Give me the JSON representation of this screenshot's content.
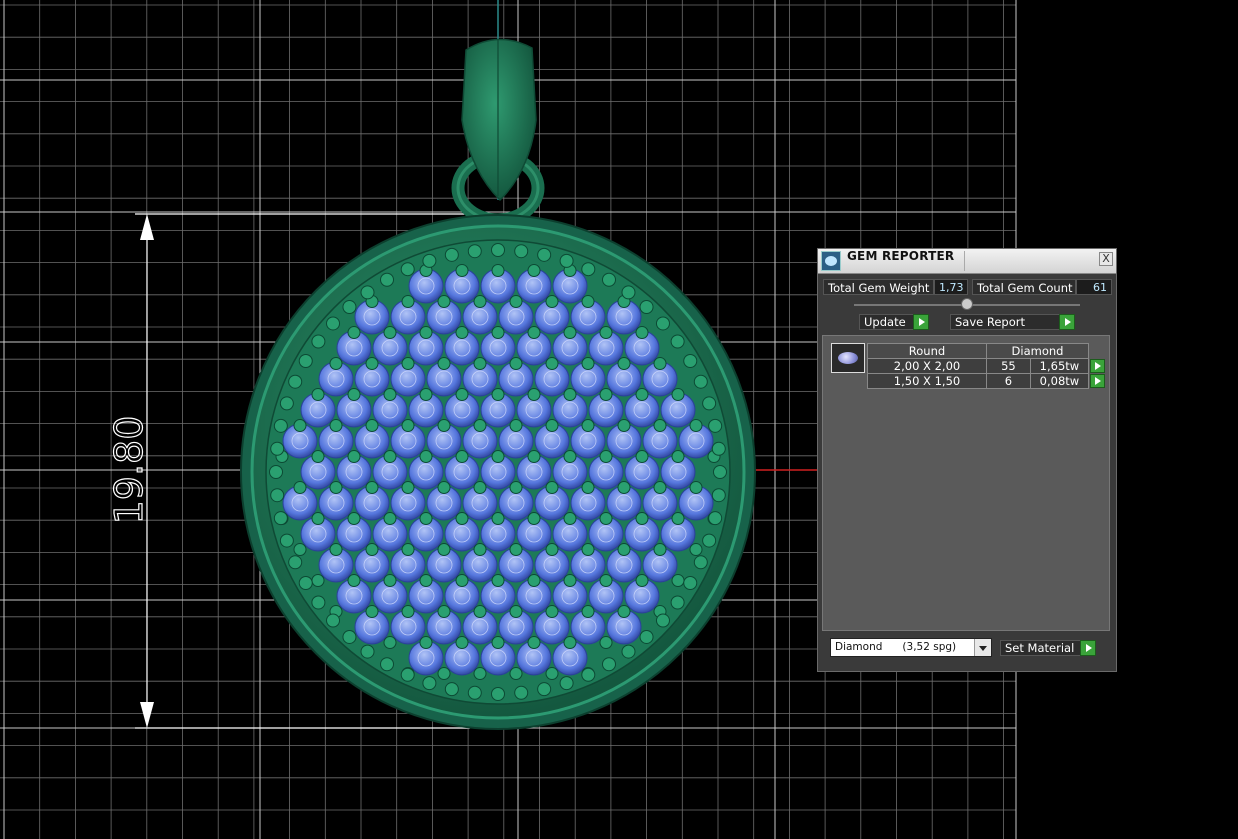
{
  "viewport": {
    "dimension_value": "19.80",
    "model": "round pave pendant with bail",
    "colors": {
      "background": "#000000",
      "grid": "#8a8a8a",
      "metal": "#238a62",
      "gem": "#5a78e6",
      "dimension": "#ffffff",
      "axis_x": "#d02020",
      "axis_y": "#2a8a8a"
    }
  },
  "gem_reporter": {
    "title": "GEM REPORTER",
    "close_label": "X",
    "total_weight_label": "Total Gem Weight",
    "total_weight_value": "1,73",
    "total_count_label": "Total Gem Count",
    "total_count_value": "61",
    "update_label": "Update",
    "save_report_label": "Save Report",
    "table": {
      "shape_header": "Round",
      "material_header": "Diamond",
      "rows": [
        {
          "size": "2,00 X 2,00",
          "count": "55",
          "weight": "1,65tw"
        },
        {
          "size": "1,50 X 1,50",
          "count": "6",
          "weight": "0,08tw"
        }
      ]
    },
    "material_select": "Diamond      (3,52 spg)",
    "set_material_label": "Set Material",
    "accent_color": "#3aa33a",
    "value_color": "#bfe9ff"
  }
}
